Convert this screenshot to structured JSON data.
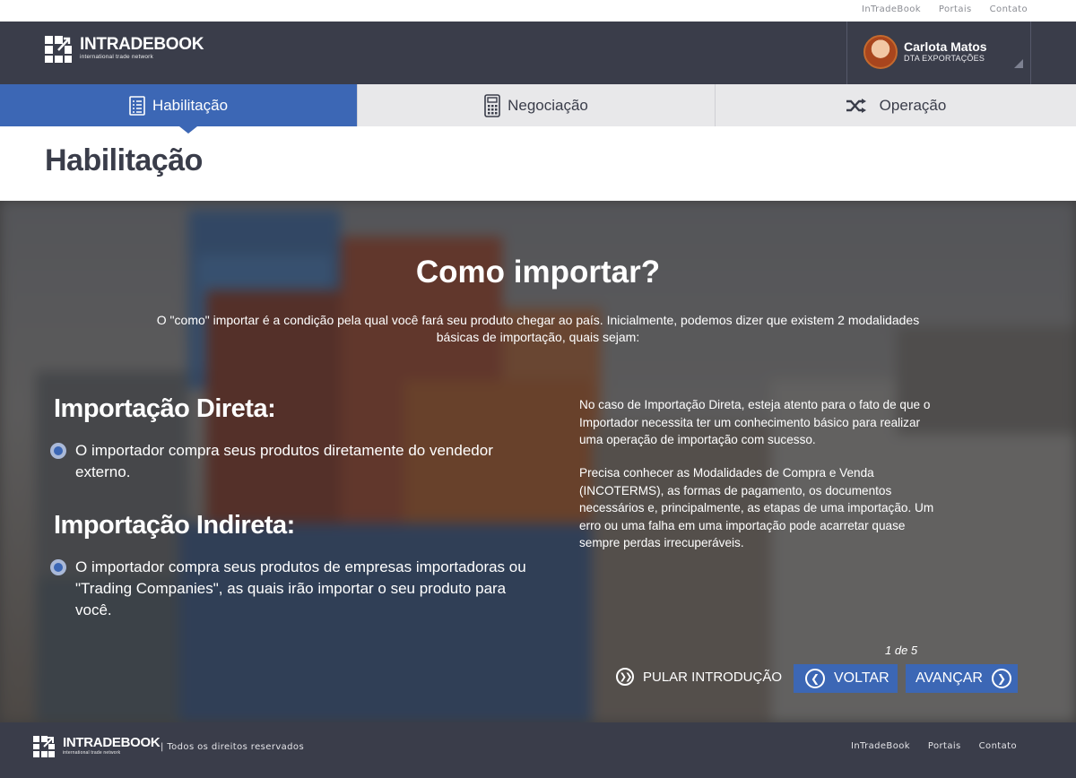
{
  "top_links": [
    "InTradeBook",
    "Portais",
    "Contato"
  ],
  "brand": {
    "name": "INTRADEBOOK",
    "tagline": "international trade network"
  },
  "user": {
    "name": "Carlota Matos",
    "role": "DTA EXPORTAÇÕES"
  },
  "tabs": [
    {
      "label": "Habilitação",
      "icon": "checklist-icon",
      "active": true
    },
    {
      "label": "Negociação",
      "icon": "calculator-icon",
      "active": false
    },
    {
      "label": "Operação",
      "icon": "shuffle-icon",
      "active": false
    }
  ],
  "page_title": "Habilitação",
  "hero": {
    "title": "Como importar?",
    "intro": "O \"como\" importar é a condição pela qual você fará seu produto chegar ao país. Inicialmente, podemos dizer que existem 2 modalidades básicas de importação, quais sejam:",
    "sections": [
      {
        "title": "Importação Direta:",
        "text": "O importador compra seus produtos diretamente do vendedor externo."
      },
      {
        "title": "Importação Indireta:",
        "text": "O importador compra seus produtos de empresas importadoras ou \"Trading Companies\", as quais irão importar o seu produto para você."
      }
    ],
    "side_paragraphs": [
      "No caso de Importação Direta, esteja atento para o fato de que o Importador necessita ter um conhecimento básico para realizar uma operação de importação com sucesso.",
      "Precisa conhecer as Modalidades de Compra e Venda (INCOTERMS), as formas de pagamento, os documentos necessários e, principalmente, as etapas de uma importação. Um erro ou uma falha em uma importação pode acarretar quase sempre perdas irrecuperáveis."
    ],
    "pager": "1 de 5",
    "skip_label": "PULAR INTRODUÇÃO",
    "back_label": "VOLTAR",
    "next_label": "AVANÇAR"
  },
  "footer": {
    "copyright": "| Todos os direitos reservados",
    "links": [
      "InTradeBook",
      "Portais",
      "Contato"
    ]
  },
  "colors": {
    "header_bg": "#3a3d4a",
    "accent": "#3c67b5",
    "tab_inactive": "#e8e8ea"
  }
}
